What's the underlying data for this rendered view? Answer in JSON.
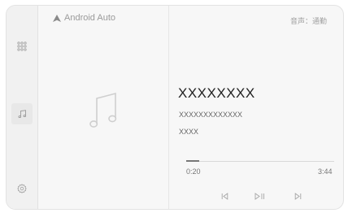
{
  "header": {
    "brand_label": "Android Auto",
    "audio_mode": "音声：通勤"
  },
  "sidebar": {
    "items": [
      {
        "icon": "apps-grid-icon"
      },
      {
        "icon": "music-note-icon",
        "active": true
      },
      {
        "icon": "settings-icon"
      }
    ]
  },
  "now_playing": {
    "title": "XXXXXXXX",
    "artist": "XXXXXXXXXXXXX",
    "album": "XXXX",
    "elapsed": "0:20",
    "duration": "3:44",
    "progress_fraction": 0.09
  },
  "controls": {
    "previous_icon": "skip-previous-icon",
    "play_pause_icon": "play-pause-icon",
    "next_icon": "skip-next-icon"
  },
  "colors": {
    "background": "#f7f7f7",
    "sidebar": "#f1f1f1",
    "icon": "#a5a5a5",
    "text_primary": "#222222"
  }
}
